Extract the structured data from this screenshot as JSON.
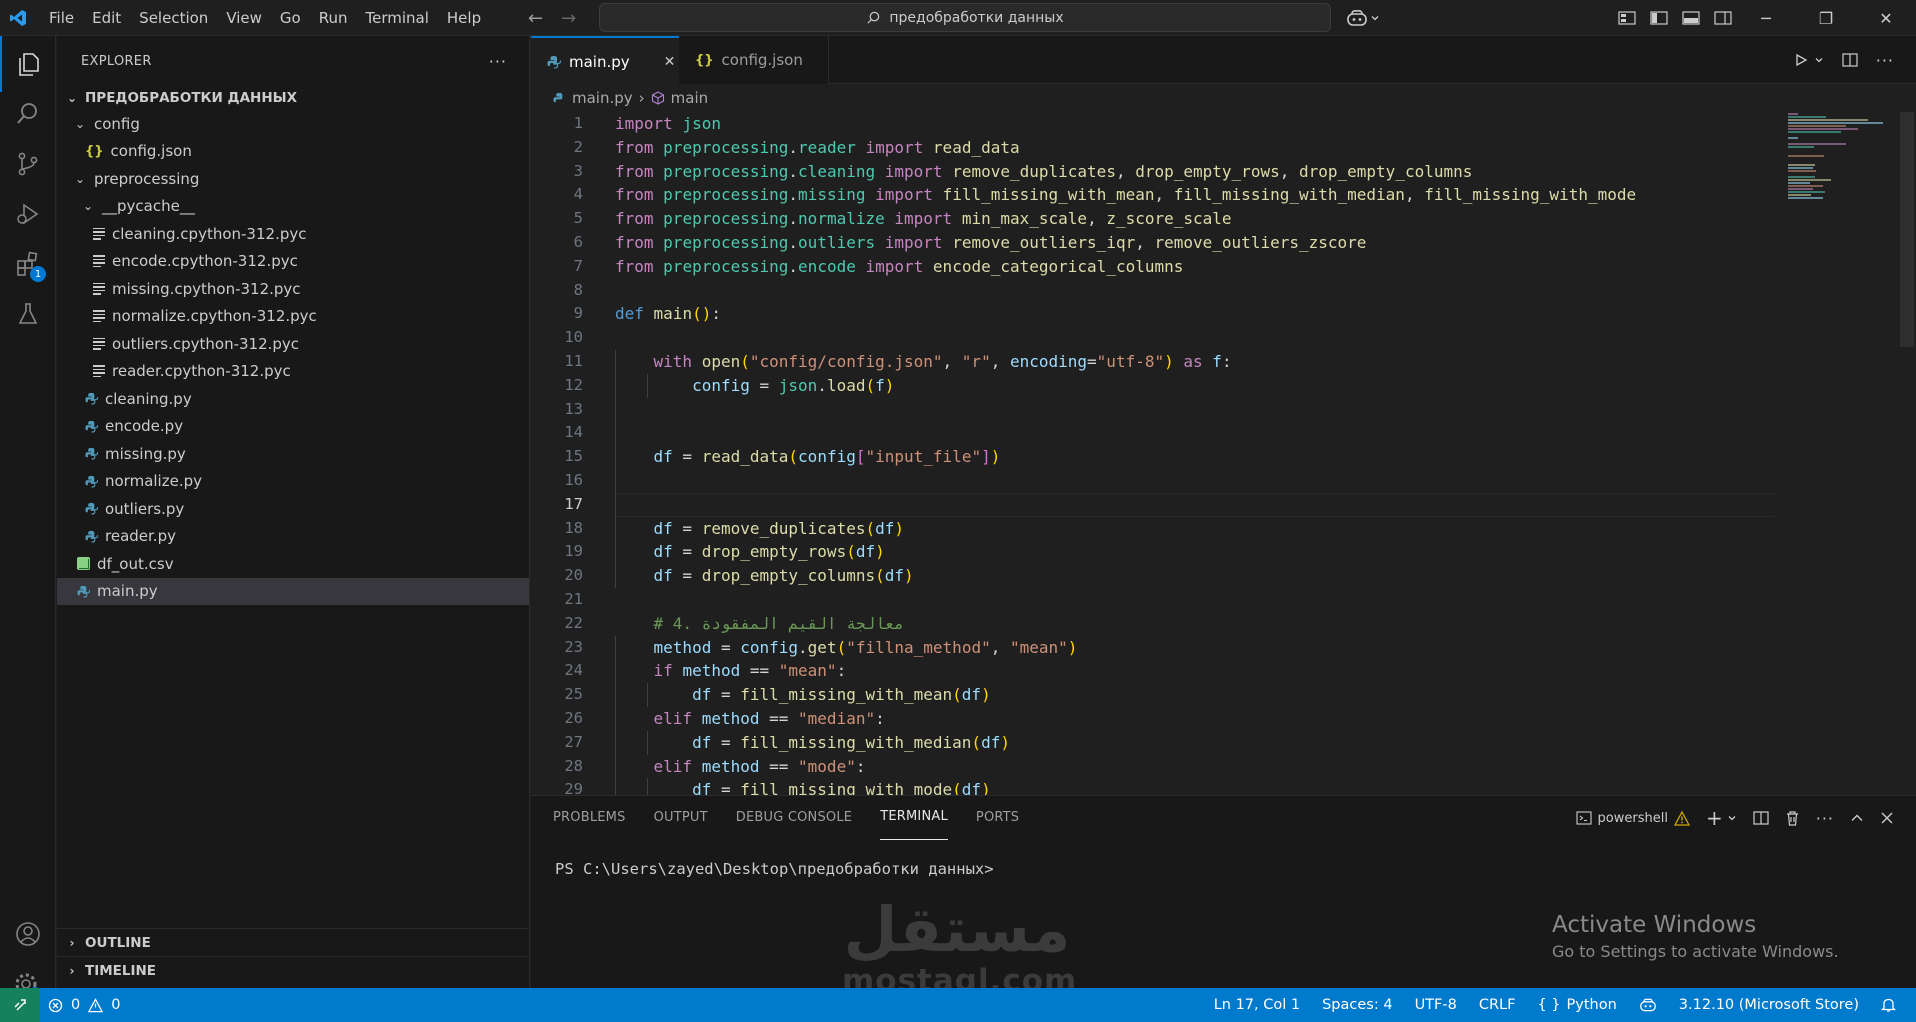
{
  "titlebar": {
    "menu": [
      "File",
      "Edit",
      "Selection",
      "View",
      "Go",
      "Run",
      "Terminal",
      "Help"
    ],
    "search_text": "предобработки данных"
  },
  "activity": {
    "extensions_badge": "1"
  },
  "explorer": {
    "title": "EXPLORER",
    "more": "···",
    "root": "ПРЕДОБРАБОТКИ ДАННЫХ",
    "items": [
      {
        "label": "config",
        "type": "folder",
        "indent": 1,
        "open": true
      },
      {
        "label": "config.json",
        "type": "json",
        "indent": 2
      },
      {
        "label": "preprocessing",
        "type": "folder",
        "indent": 1,
        "open": true
      },
      {
        "label": "__pycache__",
        "type": "folder",
        "indent": 2,
        "open": true
      },
      {
        "label": "cleaning.cpython-312.pyc",
        "type": "pyc",
        "indent": 3
      },
      {
        "label": "encode.cpython-312.pyc",
        "type": "pyc",
        "indent": 3
      },
      {
        "label": "missing.cpython-312.pyc",
        "type": "pyc",
        "indent": 3
      },
      {
        "label": "normalize.cpython-312.pyc",
        "type": "pyc",
        "indent": 3
      },
      {
        "label": "outliers.cpython-312.pyc",
        "type": "pyc",
        "indent": 3
      },
      {
        "label": "reader.cpython-312.pyc",
        "type": "pyc",
        "indent": 3
      },
      {
        "label": "cleaning.py",
        "type": "py",
        "indent": 2
      },
      {
        "label": "encode.py",
        "type": "py",
        "indent": 2
      },
      {
        "label": "missing.py",
        "type": "py",
        "indent": 2
      },
      {
        "label": "normalize.py",
        "type": "py",
        "indent": 2
      },
      {
        "label": "outliers.py",
        "type": "py",
        "indent": 2
      },
      {
        "label": "reader.py",
        "type": "py",
        "indent": 2
      },
      {
        "label": "df_out.csv",
        "type": "csv",
        "indent": 1
      },
      {
        "label": "main.py",
        "type": "py",
        "indent": 1,
        "selected": true
      }
    ],
    "outline": "OUTLINE",
    "timeline": "TIMELINE"
  },
  "tabs": [
    {
      "label": "main.py",
      "active": true,
      "close": "✕"
    },
    {
      "label": "config.json",
      "active": false
    }
  ],
  "breadcrumb": {
    "file": "main.py",
    "symbol": "main"
  },
  "code_lines": [
    [
      [
        "kw",
        "import"
      ],
      [
        "t",
        " "
      ],
      [
        "mod",
        "json"
      ]
    ],
    [
      [
        "kw",
        "from"
      ],
      [
        "t",
        " "
      ],
      [
        "mod",
        "preprocessing"
      ],
      [
        "t",
        "."
      ],
      [
        "mod",
        "reader"
      ],
      [
        "t",
        " "
      ],
      [
        "kw",
        "import"
      ],
      [
        "t",
        " "
      ],
      [
        "fn",
        "read_data"
      ]
    ],
    [
      [
        "kw",
        "from"
      ],
      [
        "t",
        " "
      ],
      [
        "mod",
        "preprocessing"
      ],
      [
        "t",
        "."
      ],
      [
        "mod",
        "cleaning"
      ],
      [
        "t",
        " "
      ],
      [
        "kw",
        "import"
      ],
      [
        "t",
        " "
      ],
      [
        "fn",
        "remove_duplicates"
      ],
      [
        "t",
        ", "
      ],
      [
        "fn",
        "drop_empty_rows"
      ],
      [
        "t",
        ", "
      ],
      [
        "fn",
        "drop_empty_columns"
      ]
    ],
    [
      [
        "kw",
        "from"
      ],
      [
        "t",
        " "
      ],
      [
        "mod",
        "preprocessing"
      ],
      [
        "t",
        "."
      ],
      [
        "mod",
        "missing"
      ],
      [
        "t",
        " "
      ],
      [
        "kw",
        "import"
      ],
      [
        "t",
        " "
      ],
      [
        "fn",
        "fill_missing_with_mean"
      ],
      [
        "t",
        ", "
      ],
      [
        "fn",
        "fill_missing_with_median"
      ],
      [
        "t",
        ", "
      ],
      [
        "fn",
        "fill_missing_with_mode"
      ]
    ],
    [
      [
        "kw",
        "from"
      ],
      [
        "t",
        " "
      ],
      [
        "mod",
        "preprocessing"
      ],
      [
        "t",
        "."
      ],
      [
        "mod",
        "normalize"
      ],
      [
        "t",
        " "
      ],
      [
        "kw",
        "import"
      ],
      [
        "t",
        " "
      ],
      [
        "fn",
        "min_max_scale"
      ],
      [
        "t",
        ", "
      ],
      [
        "fn",
        "z_score_scale"
      ]
    ],
    [
      [
        "kw",
        "from"
      ],
      [
        "t",
        " "
      ],
      [
        "mod",
        "preprocessing"
      ],
      [
        "t",
        "."
      ],
      [
        "mod",
        "outliers"
      ],
      [
        "t",
        " "
      ],
      [
        "kw",
        "import"
      ],
      [
        "t",
        " "
      ],
      [
        "fn",
        "remove_outliers_iqr"
      ],
      [
        "t",
        ", "
      ],
      [
        "fn",
        "remove_outliers_zscore"
      ]
    ],
    [
      [
        "kw",
        "from"
      ],
      [
        "t",
        " "
      ],
      [
        "mod",
        "preprocessing"
      ],
      [
        "t",
        "."
      ],
      [
        "mod",
        "encode"
      ],
      [
        "t",
        " "
      ],
      [
        "kw",
        "import"
      ],
      [
        "t",
        " "
      ],
      [
        "fn",
        "encode_categorical_columns"
      ]
    ],
    [],
    [
      [
        "kb",
        "def"
      ],
      [
        "t",
        " "
      ],
      [
        "fn",
        "main"
      ],
      [
        "br",
        "()"
      ],
      [
        "t",
        ":"
      ]
    ],
    [],
    [
      [
        "t",
        "    "
      ],
      [
        "kw",
        "with"
      ],
      [
        "t",
        " "
      ],
      [
        "fn",
        "open"
      ],
      [
        "br",
        "("
      ],
      [
        "st",
        "\"config/config.json\""
      ],
      [
        "t",
        ", "
      ],
      [
        "st",
        "\"r\""
      ],
      [
        "t",
        ", "
      ],
      [
        "vr",
        "encoding"
      ],
      [
        "t",
        "="
      ],
      [
        "st",
        "\"utf-8\""
      ],
      [
        "br",
        ")"
      ],
      [
        "t",
        " "
      ],
      [
        "kw",
        "as"
      ],
      [
        "t",
        " "
      ],
      [
        "vr",
        "f"
      ],
      [
        "t",
        ":"
      ]
    ],
    [
      [
        "t",
        "        "
      ],
      [
        "vr",
        "config"
      ],
      [
        "t",
        " = "
      ],
      [
        "mod",
        "json"
      ],
      [
        "t",
        "."
      ],
      [
        "fn",
        "load"
      ],
      [
        "br",
        "("
      ],
      [
        "vr",
        "f"
      ],
      [
        "br",
        ")"
      ]
    ],
    [],
    [],
    [
      [
        "t",
        "    "
      ],
      [
        "vr",
        "df"
      ],
      [
        "t",
        " = "
      ],
      [
        "fn",
        "read_data"
      ],
      [
        "br",
        "("
      ],
      [
        "vr",
        "config"
      ],
      [
        "br2",
        "["
      ],
      [
        "st",
        "\"input_file\""
      ],
      [
        "br2",
        "]"
      ],
      [
        "br",
        ")"
      ]
    ],
    [],
    [],
    [
      [
        "t",
        "    "
      ],
      [
        "vr",
        "df"
      ],
      [
        "t",
        " = "
      ],
      [
        "fn",
        "remove_duplicates"
      ],
      [
        "br",
        "("
      ],
      [
        "vr",
        "df"
      ],
      [
        "br",
        ")"
      ]
    ],
    [
      [
        "t",
        "    "
      ],
      [
        "vr",
        "df"
      ],
      [
        "t",
        " = "
      ],
      [
        "fn",
        "drop_empty_rows"
      ],
      [
        "br",
        "("
      ],
      [
        "vr",
        "df"
      ],
      [
        "br",
        ")"
      ]
    ],
    [
      [
        "t",
        "    "
      ],
      [
        "vr",
        "df"
      ],
      [
        "t",
        " = "
      ],
      [
        "fn",
        "drop_empty_columns"
      ],
      [
        "br",
        "("
      ],
      [
        "vr",
        "df"
      ],
      [
        "br",
        ")"
      ]
    ],
    [],
    [
      [
        "t",
        "    "
      ],
      [
        "cm",
        "# 4. معالجة القيم المفقودة"
      ]
    ],
    [
      [
        "t",
        "    "
      ],
      [
        "vr",
        "method"
      ],
      [
        "t",
        " = "
      ],
      [
        "vr",
        "config"
      ],
      [
        "t",
        "."
      ],
      [
        "fn",
        "get"
      ],
      [
        "br",
        "("
      ],
      [
        "st",
        "\"fillna_method\""
      ],
      [
        "t",
        ", "
      ],
      [
        "st",
        "\"mean\""
      ],
      [
        "br",
        ")"
      ]
    ],
    [
      [
        "t",
        "    "
      ],
      [
        "kw",
        "if"
      ],
      [
        "t",
        " "
      ],
      [
        "vr",
        "method"
      ],
      [
        "t",
        " == "
      ],
      [
        "st",
        "\"mean\""
      ],
      [
        "t",
        ":"
      ]
    ],
    [
      [
        "t",
        "        "
      ],
      [
        "vr",
        "df"
      ],
      [
        "t",
        " = "
      ],
      [
        "fn",
        "fill_missing_with_mean"
      ],
      [
        "br",
        "("
      ],
      [
        "vr",
        "df"
      ],
      [
        "br",
        ")"
      ]
    ],
    [
      [
        "t",
        "    "
      ],
      [
        "kw",
        "elif"
      ],
      [
        "t",
        " "
      ],
      [
        "vr",
        "method"
      ],
      [
        "t",
        " == "
      ],
      [
        "st",
        "\"median\""
      ],
      [
        "t",
        ":"
      ]
    ],
    [
      [
        "t",
        "        "
      ],
      [
        "vr",
        "df"
      ],
      [
        "t",
        " = "
      ],
      [
        "fn",
        "fill_missing_with_median"
      ],
      [
        "br",
        "("
      ],
      [
        "vr",
        "df"
      ],
      [
        "br",
        ")"
      ]
    ],
    [
      [
        "t",
        "    "
      ],
      [
        "kw",
        "elif"
      ],
      [
        "t",
        " "
      ],
      [
        "vr",
        "method"
      ],
      [
        "t",
        " == "
      ],
      [
        "st",
        "\"mode\""
      ],
      [
        "t",
        ":"
      ]
    ],
    [
      [
        "t",
        "        "
      ],
      [
        "vr",
        "df"
      ],
      [
        "t",
        " = "
      ],
      [
        "fn",
        "fill_missing_with_mode"
      ],
      [
        "br",
        "("
      ],
      [
        "vr",
        "df"
      ],
      [
        "br",
        ")"
      ]
    ]
  ],
  "current_line": 17,
  "panel": {
    "tabs": [
      "PROBLEMS",
      "OUTPUT",
      "DEBUG CONSOLE",
      "TERMINAL",
      "PORTS"
    ],
    "active_tab": "TERMINAL",
    "shell": "powershell",
    "prompt": "PS C:\\Users\\zayed\\Desktop\\предобработки данных>"
  },
  "overlay": {
    "activate_title": "Activate Windows",
    "activate_sub": "Go to Settings to activate Windows.",
    "watermark_ar": "مستقل",
    "watermark_en": "mostaql.com"
  },
  "status": {
    "errors": "0",
    "warnings": "0",
    "position": "Ln 17, Col 1",
    "spaces": "Spaces: 4",
    "encoding": "UTF-8",
    "eol": "CRLF",
    "language": "Python",
    "interpreter": "3.12.10 (Microsoft Store)"
  },
  "colors": {
    "accent": "#0078d4",
    "statusbar": "#007acc",
    "remote": "#16825d"
  }
}
